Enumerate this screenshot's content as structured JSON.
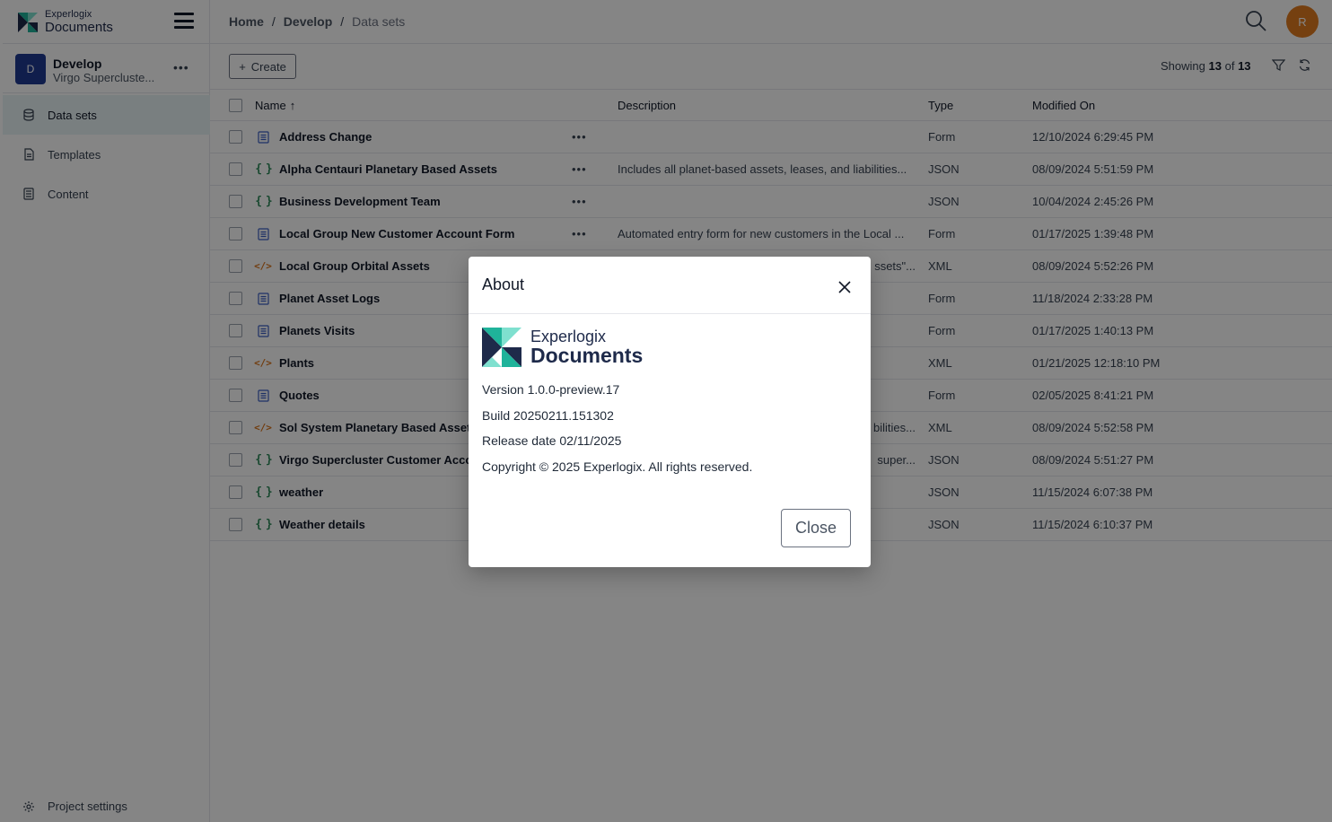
{
  "app": {
    "logo_small": "Experlogix",
    "logo_big": "Documents"
  },
  "project": {
    "avatar_letter": "D",
    "name": "Develop",
    "subtitle": "Virgo Supercluste..."
  },
  "sidebar": {
    "items": [
      {
        "label": "Data sets",
        "icon": "database-icon",
        "active": true
      },
      {
        "label": "Templates",
        "icon": "template-icon",
        "active": false
      },
      {
        "label": "Content",
        "icon": "content-icon",
        "active": false
      }
    ],
    "settings_label": "Project settings"
  },
  "header": {
    "breadcrumb": [
      "Home",
      "Develop",
      "Data sets"
    ],
    "separator": "/",
    "user_initial": "R"
  },
  "toolbar": {
    "create_label": "Create",
    "showing_prefix": "Showing",
    "showing_count": "13",
    "showing_of": "of",
    "showing_total": "13"
  },
  "table": {
    "columns": {
      "name": "Name",
      "sort_arrow": "↑",
      "description": "Description",
      "type": "Type",
      "modified": "Modified On"
    },
    "rows": [
      {
        "name": "Address Change",
        "icon": "form",
        "more": "•••",
        "description": "",
        "type": "Form",
        "modified": "12/10/2024 6:29:45 PM"
      },
      {
        "name": "Alpha Centauri Planetary Based Assets",
        "icon": "json",
        "more": "•••",
        "description": "Includes all planet-based assets, leases, and liabilities...",
        "type": "JSON",
        "modified": "08/09/2024 5:51:59 PM"
      },
      {
        "name": "Business Development Team",
        "icon": "json",
        "more": "•••",
        "description": "",
        "type": "JSON",
        "modified": "10/04/2024 2:45:26 PM"
      },
      {
        "name": "Local Group New Customer Account Form",
        "icon": "form",
        "more": "•••",
        "description": "Automated entry form for new customers in the Local ...",
        "type": "Form",
        "modified": "01/17/2025 1:39:48 PM"
      },
      {
        "name": "Local Group Orbital Assets",
        "icon": "xml",
        "more": "",
        "description": "ssets\"...",
        "type": "XML",
        "modified": "08/09/2024 5:52:26 PM"
      },
      {
        "name": "Planet Asset Logs",
        "icon": "form",
        "more": "",
        "description": "",
        "type": "Form",
        "modified": "11/18/2024 2:33:28 PM"
      },
      {
        "name": "Planets Visits",
        "icon": "form",
        "more": "",
        "description": "",
        "type": "Form",
        "modified": "01/17/2025 1:40:13 PM"
      },
      {
        "name": "Plants",
        "icon": "xml",
        "more": "",
        "description": "",
        "type": "XML",
        "modified": "01/21/2025 12:18:10 PM"
      },
      {
        "name": "Quotes",
        "icon": "form",
        "more": "",
        "description": "",
        "type": "Form",
        "modified": "02/05/2025 8:41:21 PM"
      },
      {
        "name": "Sol System Planetary Based Assets",
        "icon": "xml",
        "more": "",
        "description": "bilities...",
        "type": "XML",
        "modified": "08/09/2024 5:52:58 PM"
      },
      {
        "name": "Virgo Supercluster Customer Acco",
        "icon": "json",
        "more": "",
        "description": "super...",
        "type": "JSON",
        "modified": "08/09/2024 5:51:27 PM"
      },
      {
        "name": "weather",
        "icon": "json",
        "more": "",
        "description": "",
        "type": "JSON",
        "modified": "11/15/2024 6:07:38 PM"
      },
      {
        "name": "Weather details",
        "icon": "json",
        "more": "",
        "description": "",
        "type": "JSON",
        "modified": "11/15/2024 6:10:37 PM"
      }
    ]
  },
  "modal": {
    "title": "About",
    "logo_small": "Experlogix",
    "logo_big": "Documents",
    "version": "Version 1.0.0-preview.17",
    "build": "Build 20250211.151302",
    "release": "Release date 02/11/2025",
    "copyright": "Copyright © 2025 Experlogix. All rights reserved.",
    "close_label": "Close"
  },
  "colors": {
    "brand_dark": "#1e2a4a",
    "brand_teal": "#1fb39a",
    "project_avatar": "#1f3a93",
    "user_avatar": "#e07c1f",
    "json_icon": "#2f8a5b",
    "xml_icon": "#d9731a",
    "form_icon": "#3b5fc4"
  }
}
